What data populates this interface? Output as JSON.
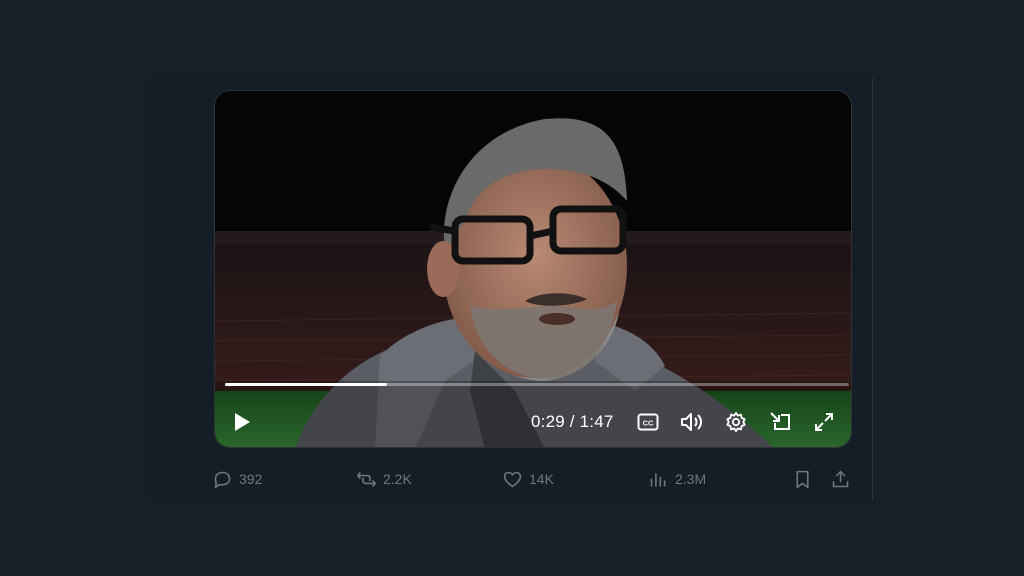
{
  "video": {
    "progress": 0.26,
    "time_label": "0:29 / 1:47",
    "controls": {
      "play_icon": "play-icon",
      "captions_icon": "captions-icon",
      "volume_icon": "volume-icon",
      "settings_icon": "gear-icon",
      "pip_icon": "picture-in-picture-icon",
      "fullscreen_icon": "fullscreen-icon"
    }
  },
  "engagement": {
    "replies": "392",
    "reposts": "2.2K",
    "likes": "14K",
    "views": "2.3M"
  },
  "colors": {
    "background": "#172029",
    "muted_text": "#71767b",
    "pitch_green": "#2f7a34"
  }
}
